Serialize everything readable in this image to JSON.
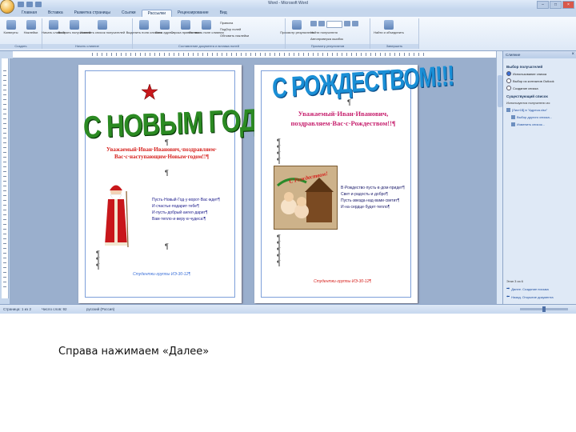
{
  "window": {
    "title": "Word - Microsoft Word"
  },
  "tabs": [
    "Главная",
    "Вставка",
    "Разметка страницы",
    "Ссылки",
    "Рассылки",
    "Рецензирование",
    "Вид"
  ],
  "active_tab": "Рассылки",
  "ribbon": {
    "groups": [
      {
        "label": "Создать",
        "buttons": [
          "Конверты",
          "Наклейки"
        ]
      },
      {
        "label": "Начать слияние",
        "buttons": [
          "Начать слияние",
          "Выбрать получателей",
          "Изменить список получателей"
        ]
      },
      {
        "label": "Составление документа и вставка полей",
        "buttons": [
          "Выделить поля слияния",
          "Блок адреса",
          "Строка приветствия",
          "Вставить поле слияния"
        ],
        "small": [
          "Правила",
          "Подбор полей",
          "Обновить наклейки"
        ]
      },
      {
        "label": "Просмотр результатов",
        "buttons": [
          "Просмотр результатов"
        ],
        "small": [
          "Найти получателя",
          "Автопроверка ошибок"
        ]
      },
      {
        "label": "Завершить",
        "buttons": [
          "Найти и объединить"
        ]
      }
    ]
  },
  "document": {
    "page1": {
      "title": "С НОВЫМ ГОДОМ",
      "greeting": "Уважаемый·Иван·Иванович,·поздравляем· Вас·с·наступающим·Новым·годом!!¶",
      "verse": [
        "Пусть·Новый·Год·у·ворот·Вас·ждет¶",
        "И·счастье·подарит·тебе¶",
        "И·пусть·добрый·ангел·дарит¶",
        "Вам·тепло·и·веру·в·чудеса!¶"
      ],
      "footer": "Студентки·группы·ИЭ-30-12¶"
    },
    "page2": {
      "title": "С РОЖДЕСТВОМ!!!",
      "greeting": "Уважаемый·Иван·Иванович, поздравляем·Вас·с·Рождеством!!¶",
      "picture_text": "С Рождеством!",
      "verse": [
        "В·Рождество·пусть·в·дом·придет¶",
        "Свет·и·радость·и·добро¶",
        "Пусть·звезда·над·вами·светит¶",
        "И·на·сердце·будет·тепло¶"
      ],
      "footer": "Студентки·группы·ИЭ-30-12¶"
    }
  },
  "task_pane": {
    "title": "Слияние",
    "section1": "Выбор получателей",
    "options": [
      "Использование списка",
      "Выбор из контактов Outlook",
      "Создание списка"
    ],
    "section2": "Существующий список",
    "text": "Используются получатели из:",
    "file": "[Лист1$] в \"Адреса.xlsx\"",
    "links": [
      "Выбор другого списка...",
      "Изменить список..."
    ],
    "step": "Этап 3 из 6",
    "next": "Далее. Создание письма",
    "prev": "Назад. Открытие документа"
  },
  "status_bar": {
    "page": "Страница: 1 из 2",
    "words": "Число слов: 92",
    "lang": "русский (Россия)"
  },
  "caption": "Справа нажимаем «Далее»"
}
